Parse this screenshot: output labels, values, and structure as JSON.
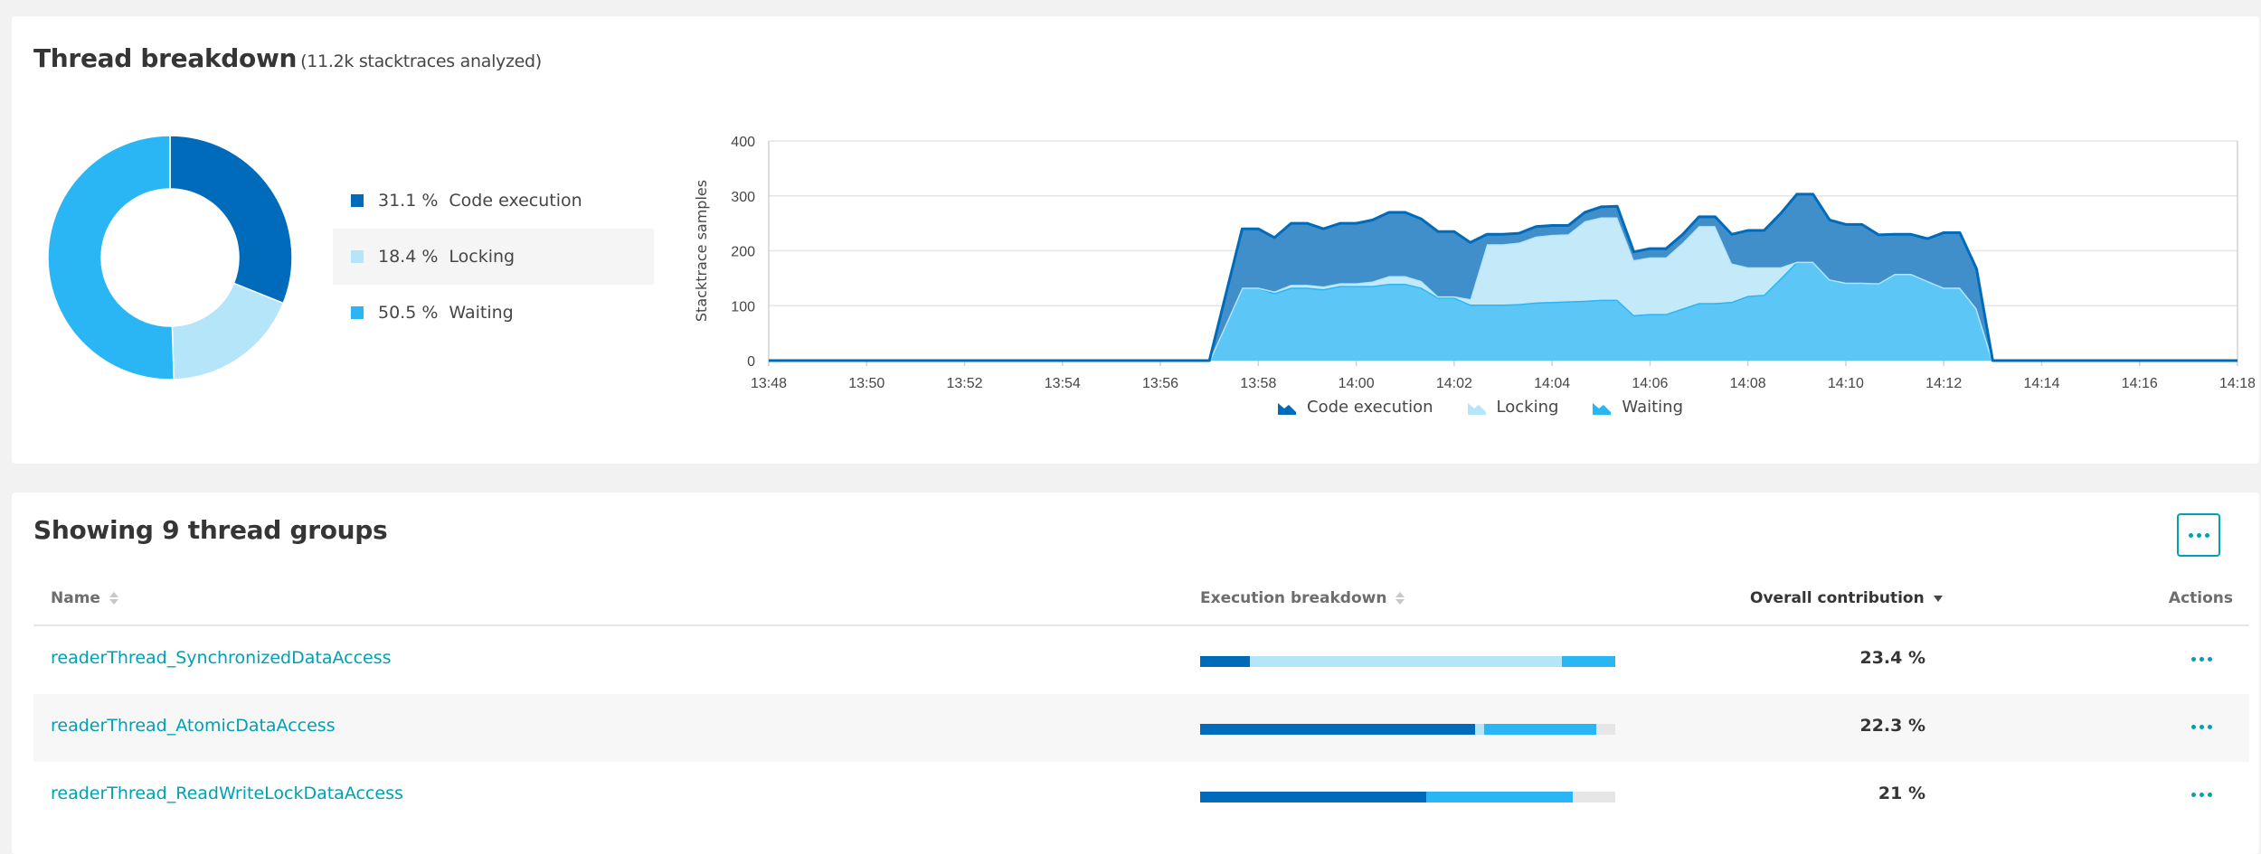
{
  "breakdown": {
    "title": "Thread breakdown",
    "subtitle": "(11.2k stacktraces analyzed)",
    "colors": {
      "code": "#006bba",
      "locking": "#b4e5f9",
      "waiting": "#2ab6f4"
    },
    "legend": [
      {
        "key": "code",
        "pct": "31.1 %",
        "label": "Code execution"
      },
      {
        "key": "locking",
        "pct": "18.4 %",
        "label": "Locking"
      },
      {
        "key": "waiting",
        "pct": "50.5 %",
        "label": "Waiting"
      }
    ]
  },
  "chart_data": [
    {
      "type": "pie",
      "variant": "donut",
      "title": "Thread breakdown",
      "categories": [
        "Code execution",
        "Locking",
        "Waiting"
      ],
      "values": [
        31.1,
        18.4,
        50.5
      ],
      "colors": [
        "#006bba",
        "#b4e5f9",
        "#2ab6f4"
      ]
    },
    {
      "type": "area",
      "stacked": true,
      "title": "",
      "xlabel": "",
      "ylabel": "Stacktrace samples",
      "ylim": [
        0,
        400
      ],
      "yticks": [
        0,
        100,
        200,
        300,
        400
      ],
      "xticks": [
        "13:48",
        "13:50",
        "13:52",
        "13:54",
        "13:56",
        "13:58",
        "14:00",
        "14:02",
        "14:04",
        "14:06",
        "14:08",
        "14:10",
        "14:12",
        "14:14",
        "14:16",
        "14:18"
      ],
      "x_range_minutes": [
        0,
        30
      ],
      "x_origin": "13:48",
      "grid": true,
      "legend_position": "bottom",
      "x_minutes": [
        0,
        9.0,
        9.67,
        10.0,
        10.33,
        10.67,
        11.0,
        11.33,
        11.67,
        12.0,
        12.33,
        12.67,
        13.0,
        13.33,
        13.67,
        14.0,
        14.33,
        14.67,
        15.0,
        15.33,
        15.67,
        16.0,
        16.33,
        16.67,
        17.0,
        17.33,
        17.67,
        18.0,
        18.33,
        18.67,
        19.0,
        19.33,
        19.67,
        20.0,
        20.33,
        20.67,
        21.0,
        21.33,
        21.67,
        22.0,
        22.33,
        22.67,
        23.0,
        23.33,
        23.67,
        24.0,
        24.33,
        24.67,
        25.0,
        30
      ],
      "series": [
        {
          "name": "Waiting",
          "color": "#2ab6f4",
          "values": [
            0,
            0,
            133,
            133,
            123,
            133,
            133,
            130,
            136,
            136,
            136,
            140,
            140,
            133,
            115,
            115,
            102,
            102,
            102,
            103,
            106,
            107,
            108,
            109,
            111,
            111,
            83,
            85,
            85,
            95,
            105,
            105,
            107,
            118,
            120,
            150,
            180,
            180,
            148,
            142,
            142,
            141,
            158,
            158,
            145,
            133,
            133,
            95,
            0,
            0
          ]
        },
        {
          "name": "Locking",
          "color": "#b4e5f9",
          "values": [
            0,
            0,
            0,
            0,
            3,
            5,
            5,
            5,
            5,
            5,
            8,
            14,
            14,
            12,
            2,
            2,
            10,
            110,
            110,
            112,
            120,
            122,
            122,
            145,
            150,
            150,
            100,
            103,
            103,
            120,
            140,
            140,
            70,
            52,
            50,
            20,
            0,
            0,
            0,
            0,
            0,
            0,
            0,
            0,
            0,
            0,
            0,
            0,
            0,
            0
          ]
        },
        {
          "name": "Code execution",
          "color": "#006bba",
          "values": [
            0,
            0,
            107,
            107,
            98,
            112,
            112,
            105,
            109,
            109,
            112,
            116,
            116,
            113,
            118,
            118,
            103,
            18,
            18,
            17,
            18,
            17,
            16,
            16,
            19,
            20,
            15,
            16,
            16,
            15,
            17,
            17,
            53,
            67,
            67,
            98,
            123,
            123,
            108,
            106,
            106,
            88,
            72,
            72,
            77,
            100,
            100,
            72,
            0,
            0
          ]
        }
      ]
    }
  ],
  "chart_legend": [
    {
      "key": "code",
      "label": "Code execution",
      "color": "#006bba"
    },
    {
      "key": "locking",
      "label": "Locking",
      "color": "#b4e5f9"
    },
    {
      "key": "waiting",
      "label": "Waiting",
      "color": "#2ab6f4"
    }
  ],
  "groups": {
    "title": "Showing 9 thread groups",
    "more_icon": "more-horizontal-icon",
    "columns": {
      "name": "Name",
      "breakdown": "Execution breakdown",
      "contribution": "Overall contribution",
      "actions": "Actions"
    },
    "rows": [
      {
        "name": "readerThread_SynchronizedDataAccess",
        "contribution": "23.4 %",
        "breakdown": {
          "code": 12.0,
          "locking": 75.2,
          "waiting": 12.8,
          "other": 0
        }
      },
      {
        "name": "readerThread_AtomicDataAccess",
        "contribution": "22.3 %",
        "breakdown": {
          "code": 66.2,
          "locking": 2.2,
          "waiting": 27.0,
          "other": 4.6
        }
      },
      {
        "name": "readerThread_ReadWriteLockDataAccess",
        "contribution": "21 %",
        "breakdown": {
          "code": 54.5,
          "locking": 0,
          "waiting": 35.3,
          "other": 10.2
        }
      }
    ]
  }
}
